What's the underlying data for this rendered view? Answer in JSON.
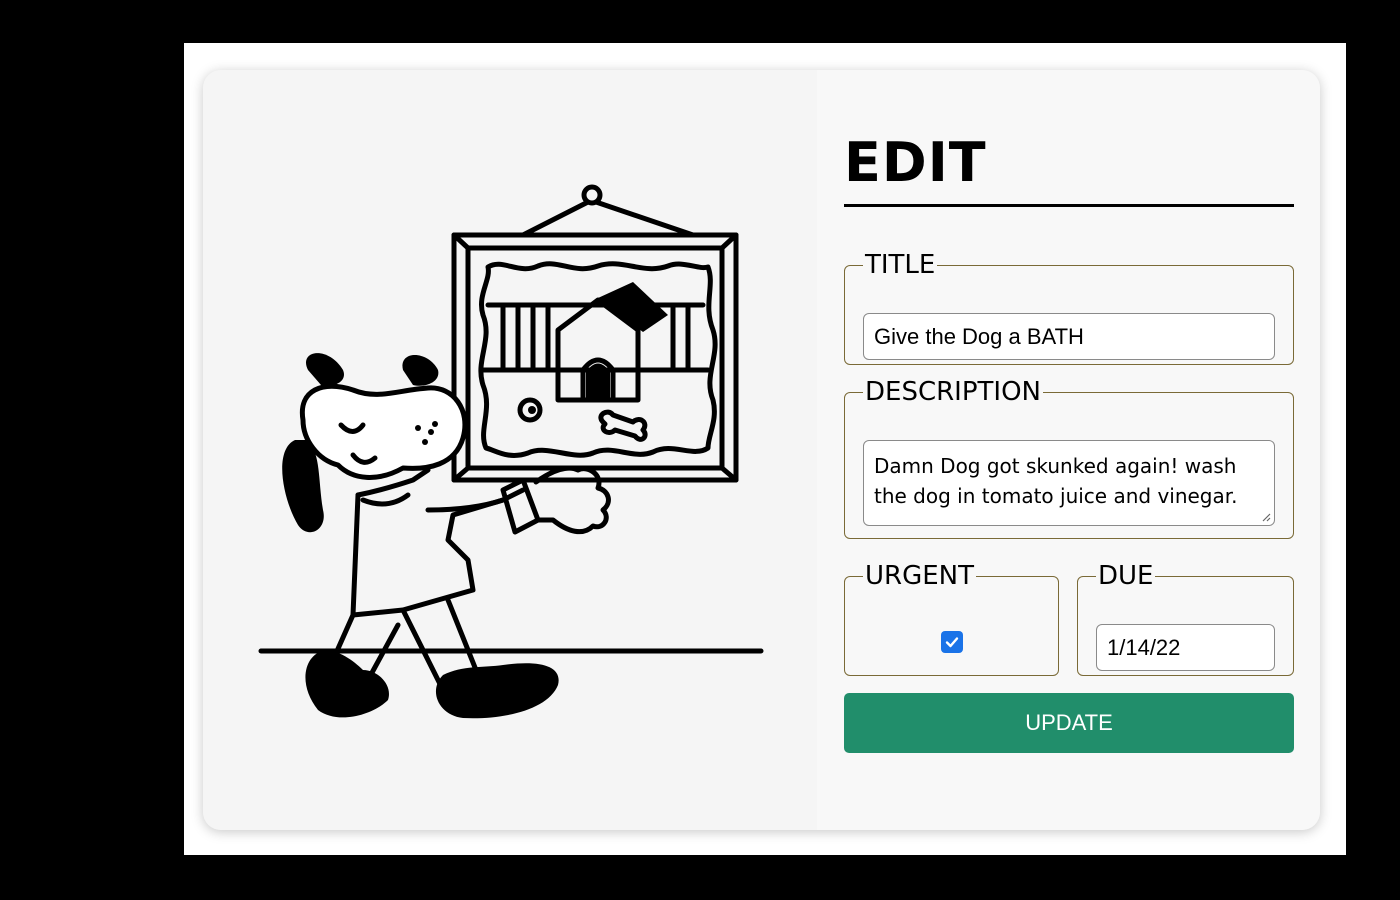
{
  "form": {
    "heading": "EDIT",
    "title": {
      "legend": "TITLE",
      "value": "Give the Dog a BATH"
    },
    "description": {
      "legend": "DESCRIPTION",
      "value": "Damn Dog got skunked again! wash the dog in tomato juice and vinegar."
    },
    "urgent": {
      "legend": "URGENT",
      "checked": true
    },
    "due": {
      "legend": "DUE",
      "value": "1/14/22"
    },
    "update_label": "UPDATE"
  },
  "colors": {
    "accent": "#218e6b",
    "fieldset_border": "#7a6a37",
    "checkbox": "#1a73e8"
  },
  "illustration": {
    "icon": "dog-carrying-framed-picture-illustration"
  }
}
